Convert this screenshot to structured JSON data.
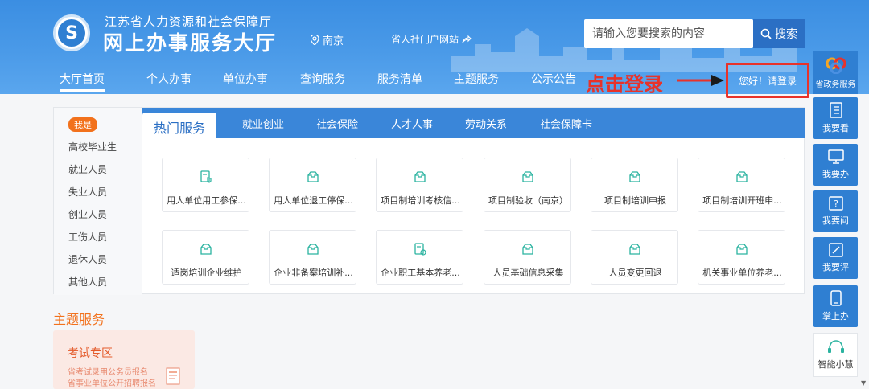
{
  "header": {
    "org_line": "江苏省人力资源和社会保障厅",
    "site_title": "网上办事服务大厅",
    "location": "南京",
    "portal_link": "省人社门户网站",
    "search_placeholder": "请输入您要搜索的内容",
    "search_button": "搜索",
    "login_text": "您好！请登录",
    "annotation": "点击登录",
    "annotation_color": "#e8322a"
  },
  "nav": [
    "大厅首页",
    "个人办事",
    "单位办事",
    "查询服务",
    "服务清单",
    "主题服务",
    "公示公告"
  ],
  "left_panel": {
    "badge": "我是",
    "items": [
      "高校毕业生",
      "就业人员",
      "失业人员",
      "创业人员",
      "工伤人员",
      "退休人员",
      "其他人员"
    ]
  },
  "tabs": [
    "热门服务",
    "就业创业",
    "社会保险",
    "人才人事",
    "劳动关系",
    "社会保障卡"
  ],
  "services_row1": [
    "用人单位用工参保...",
    "用人单位退工停保...",
    "项目制培训考核信...",
    "项目制验收（南京）",
    "项目制培训申报",
    "项目制培训开班申..."
  ],
  "services_row2": [
    "适岗培训企业维护",
    "企业非备案培训补...",
    "企业职工基本养老...",
    "人员基础信息采集",
    "人员变更回退",
    "机关事业单位养老..."
  ],
  "theme": {
    "title": "主题服务",
    "exam_title": "考试专区",
    "exam_lines": [
      "省考试录用公务员报名",
      "省事业单位公开招聘报名"
    ]
  },
  "sidebar": {
    "top": "省政务服务",
    "buttons": [
      "我要看",
      "我要办",
      "我要问",
      "我要评",
      "掌上办"
    ],
    "ai": "智能小慧"
  },
  "colors": {
    "header_blue": "#4a9ae8",
    "accent_blue": "#2f7fd2",
    "orange": "#f2711c"
  }
}
